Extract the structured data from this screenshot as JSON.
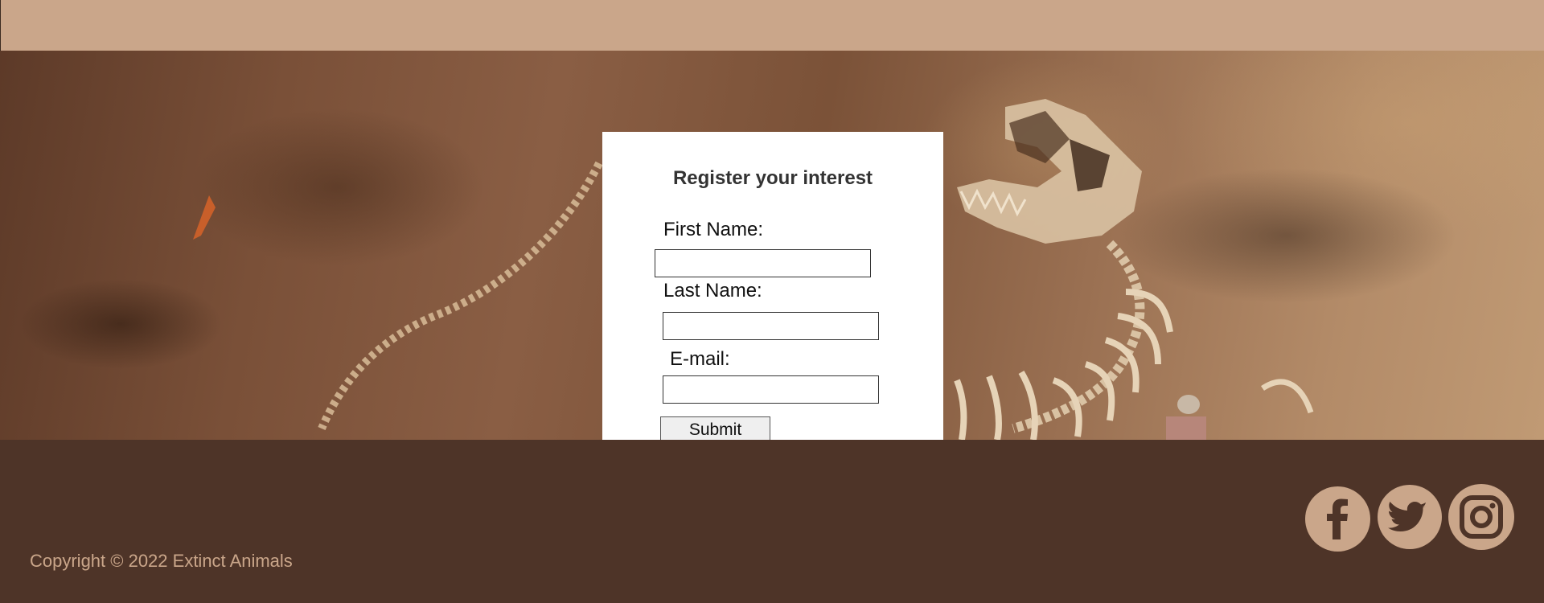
{
  "form": {
    "title": "Register your interest",
    "first_name_label": "First Name:",
    "last_name_label": "Last Name:",
    "email_label": "E-mail:",
    "first_name_value": "",
    "last_name_value": "",
    "email_value": "",
    "submit_label": "Submit"
  },
  "footer": {
    "copyright": "Copyright © 2022 Extinct Animals",
    "social": [
      {
        "name": "facebook-icon"
      },
      {
        "name": "twitter-icon"
      },
      {
        "name": "instagram-icon"
      }
    ]
  },
  "colors": {
    "header": "#caa68a",
    "footer": "#4e3428",
    "accent": "#caa68a"
  }
}
